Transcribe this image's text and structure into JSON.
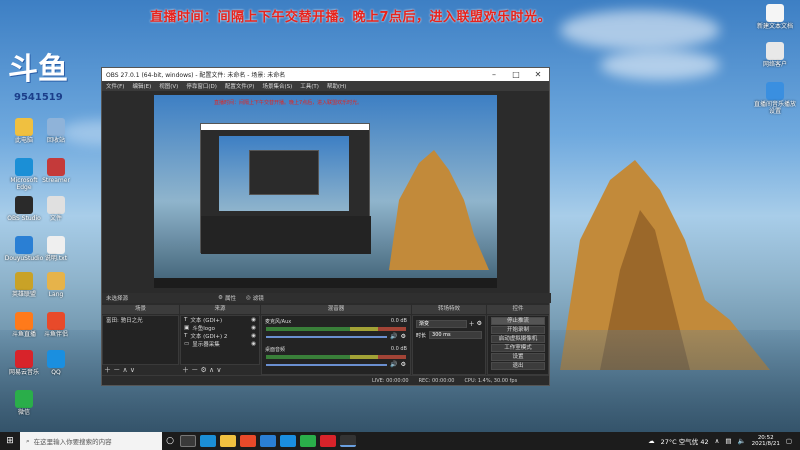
{
  "banner": "直播时间：间隔上下午交替开播。晚上7点后，进入联盟欢乐时光。",
  "logo": {
    "mark": "斗鱼",
    "room": "9541519"
  },
  "desktop_icons": [
    {
      "label": "此电脑",
      "color": "#f0c040"
    },
    {
      "label": "回收站",
      "color": "#8fb3d9"
    },
    {
      "label": "Microsoft Edge",
      "color": "#1b8fd6"
    },
    {
      "label": "Streamer",
      "color": "#c43a3a"
    },
    {
      "label": "OBS Studio",
      "color": "#2a2a2a"
    },
    {
      "label": "文件",
      "color": "#e0e0e0"
    },
    {
      "label": "DouyuStudio",
      "color": "#2a7fd4"
    },
    {
      "label": "说明.txt",
      "color": "#efefef"
    },
    {
      "label": "英雄联盟",
      "color": "#c9a227"
    },
    {
      "label": "Lang",
      "color": "#e6b34a"
    },
    {
      "label": "斗鱼直播",
      "color": "#ff7a1a"
    },
    {
      "label": "斗鱼伴侣",
      "color": "#e84a2a"
    },
    {
      "label": "网易云音乐",
      "color": "#d8232a"
    },
    {
      "label": "QQ",
      "color": "#1a8fe0"
    },
    {
      "label": "微信",
      "color": "#2aae4a"
    }
  ],
  "right_icons": [
    {
      "label": "新建文本文档",
      "color": "#f5f5f5"
    },
    {
      "label": "网络客户",
      "color": "#e8e8e8"
    },
    {
      "label": "直播间音乐播放设置",
      "color": "#3a8fe0"
    }
  ],
  "obs": {
    "title": "OBS 27.0.1 (64-bit, windows) - 配置文件: 未命名 - 场景: 未命名",
    "menu": [
      "文件(F)",
      "编辑(E)",
      "视图(V)",
      "停靠窗口(D)",
      "配置文件(P)",
      "场景集合(S)",
      "工具(T)",
      "帮助(H)"
    ],
    "no_source": "未选择源",
    "props_btn": "属性",
    "filter_btn": "滤镜",
    "panels": {
      "scenes": "场景",
      "sources": "来源",
      "mixer": "混音器",
      "transitions": "转场特效",
      "controls": "控件"
    },
    "scenes": [
      "富田: 驰日之光"
    ],
    "sources": [
      "文本 (GDI+)",
      "斗鱼logo",
      "文本 (GDI+) 2",
      "显示器采集"
    ],
    "mixer": [
      {
        "name": "麦克风/Aux",
        "db": "0.0 dB"
      },
      {
        "name": "桌面音频",
        "db": "0.0 dB"
      }
    ],
    "transitions": {
      "type": "渐变",
      "duration_label": "时长",
      "duration": "300 ms"
    },
    "controls": [
      "停止推流",
      "开始录制",
      "启动虚拟摄像机",
      "工作室模式",
      "设置",
      "退出"
    ],
    "status": {
      "live": "LIVE: 00:00:00",
      "rec": "REC: 00:00:00",
      "cpu": "CPU: 1.4%, 30.00 fps"
    }
  },
  "taskbar": {
    "search_placeholder": "在这里输入你要搜索的内容",
    "weather": "27°C 空气优 42",
    "time": "20:52",
    "date": "2021/8/21"
  }
}
